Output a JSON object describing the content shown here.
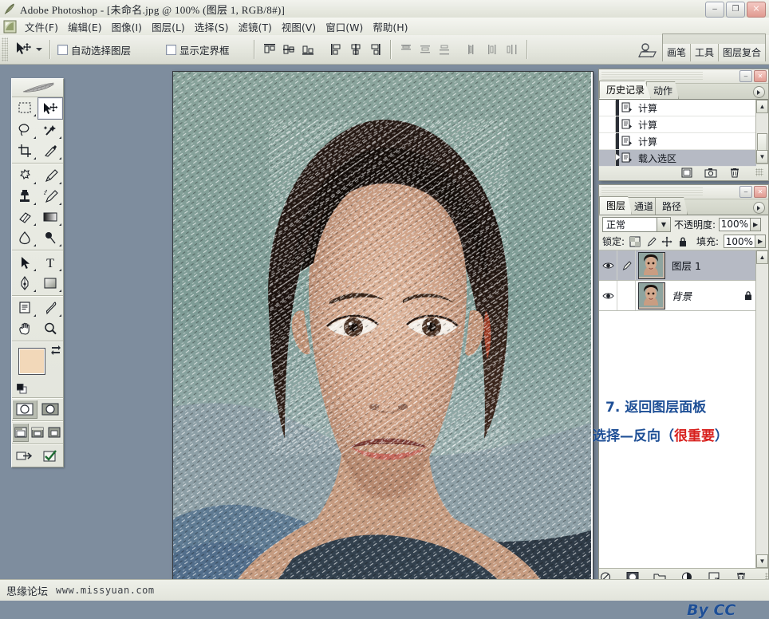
{
  "window": {
    "title": "Adobe Photoshop - [未命名.jpg @ 100% (图层 1, RGB/8#)]",
    "app_icon": "photoshop-feather-icon",
    "minimize": "–",
    "restore": "❐",
    "close": "✕"
  },
  "menubar": {
    "doc_icon": "document-control-icon",
    "items": [
      {
        "label": "文件(F)"
      },
      {
        "label": "编辑(E)"
      },
      {
        "label": "图像(I)"
      },
      {
        "label": "图层(L)"
      },
      {
        "label": "选择(S)"
      },
      {
        "label": "滤镜(T)"
      },
      {
        "label": "视图(V)"
      },
      {
        "label": "窗口(W)"
      },
      {
        "label": "帮助(H)"
      }
    ]
  },
  "options_bar": {
    "active_tool": "move-tool",
    "auto_select_label": "自动选择图层",
    "auto_select_checked": false,
    "show_bbox_label": "显示定界框",
    "show_bbox_checked": false,
    "align_buttons": [
      "align-top-edges",
      "align-vertical-centers",
      "align-bottom-edges",
      "align-left-edges",
      "align-horizontal-centers",
      "align-right-edges"
    ],
    "distribute_buttons": [
      "distribute-top-edges",
      "distribute-vertical-centers",
      "distribute-bottom-edges",
      "distribute-left-edges",
      "distribute-horizontal-centers",
      "distribute-right-edges"
    ],
    "person_icon": "file-browser-icon",
    "palette_well": [
      {
        "label": "画笔"
      },
      {
        "label": "工具"
      },
      {
        "label": "图层复合"
      }
    ]
  },
  "toolbox": {
    "header_icon": "photoshop-feather-logo",
    "foreground_color": "#f2d8b9",
    "background_color": "#ffffff",
    "selected_tool": "move-tool",
    "rows": [
      {
        "left": "marquee-tool",
        "right": "move-tool"
      },
      {
        "left": "lasso-tool",
        "right": "magic-wand-tool"
      },
      {
        "left": "crop-tool",
        "right": "slice-tool"
      },
      {
        "left": "healing-brush-tool",
        "right": "brush-tool"
      },
      {
        "left": "clone-stamp-tool",
        "right": "history-brush-tool"
      },
      {
        "left": "eraser-tool",
        "right": "gradient-tool"
      },
      {
        "left": "blur-tool",
        "right": "dodge-tool"
      },
      {
        "left": "path-selection-tool",
        "right": "type-tool"
      },
      {
        "left": "pen-tool",
        "right": "shape-tool"
      },
      {
        "left": "notes-tool",
        "right": "eyedropper-tool"
      },
      {
        "left": "hand-tool",
        "right": "zoom-tool"
      }
    ],
    "quick_mask": [
      "standard-mode",
      "quick-mask-mode"
    ],
    "screen_modes": [
      "standard-screen-mode",
      "full-screen-with-menubar",
      "full-screen-mode"
    ],
    "jump_to": [
      "jump-to-imageready",
      "edit-in-imageready"
    ]
  },
  "history_palette": {
    "tabs": [
      {
        "label": "历史记录",
        "active": true
      },
      {
        "label": "动作",
        "active": false
      }
    ],
    "entries": [
      {
        "label": "计算",
        "selected": false
      },
      {
        "label": "计算",
        "selected": false
      },
      {
        "label": "计算",
        "selected": false
      },
      {
        "label": "载入选区",
        "selected": true
      }
    ],
    "footer_buttons": [
      "create-document-from-state",
      "create-new-snapshot",
      "delete-state"
    ]
  },
  "layers_palette": {
    "tabs": [
      {
        "label": "图层",
        "active": true
      },
      {
        "label": "通道",
        "active": false
      },
      {
        "label": "路径",
        "active": false
      }
    ],
    "blend_mode": "正常",
    "opacity_label": "不透明度:",
    "opacity_value": "100%",
    "lock_label": "锁定:",
    "lock_icons": [
      "lock-transparency-icon",
      "lock-image-icon",
      "lock-position-icon",
      "lock-all-icon"
    ],
    "fill_label": "填充:",
    "fill_value": "100%",
    "layers": [
      {
        "name": "图层 1",
        "visible": true,
        "selected": true,
        "has_brush_icon": true,
        "locked": false
      },
      {
        "name": "背景",
        "visible": true,
        "selected": false,
        "has_brush_icon": false,
        "locked": true
      }
    ],
    "footer_buttons": [
      "layer-style-icon",
      "layer-mask-icon",
      "new-group-icon",
      "new-adjustment-layer-icon",
      "new-layer-icon",
      "delete-layer-icon"
    ]
  },
  "annotations": {
    "line1": "7. 返回图层面板",
    "line2_prefix": "选择—反向（",
    "line2_red": "很重要",
    "line2_suffix": "）",
    "signature": "By  CC",
    "color_blue": "#1e4f96",
    "color_red": "#d8201d"
  },
  "statusbar": {
    "forum_name": "思缘论坛",
    "forum_url": "www.missyuan.com"
  },
  "document": {
    "zoom": "100%",
    "filename": "未命名.jpg",
    "mode": "RGB/8#",
    "layer": "图层 1"
  }
}
